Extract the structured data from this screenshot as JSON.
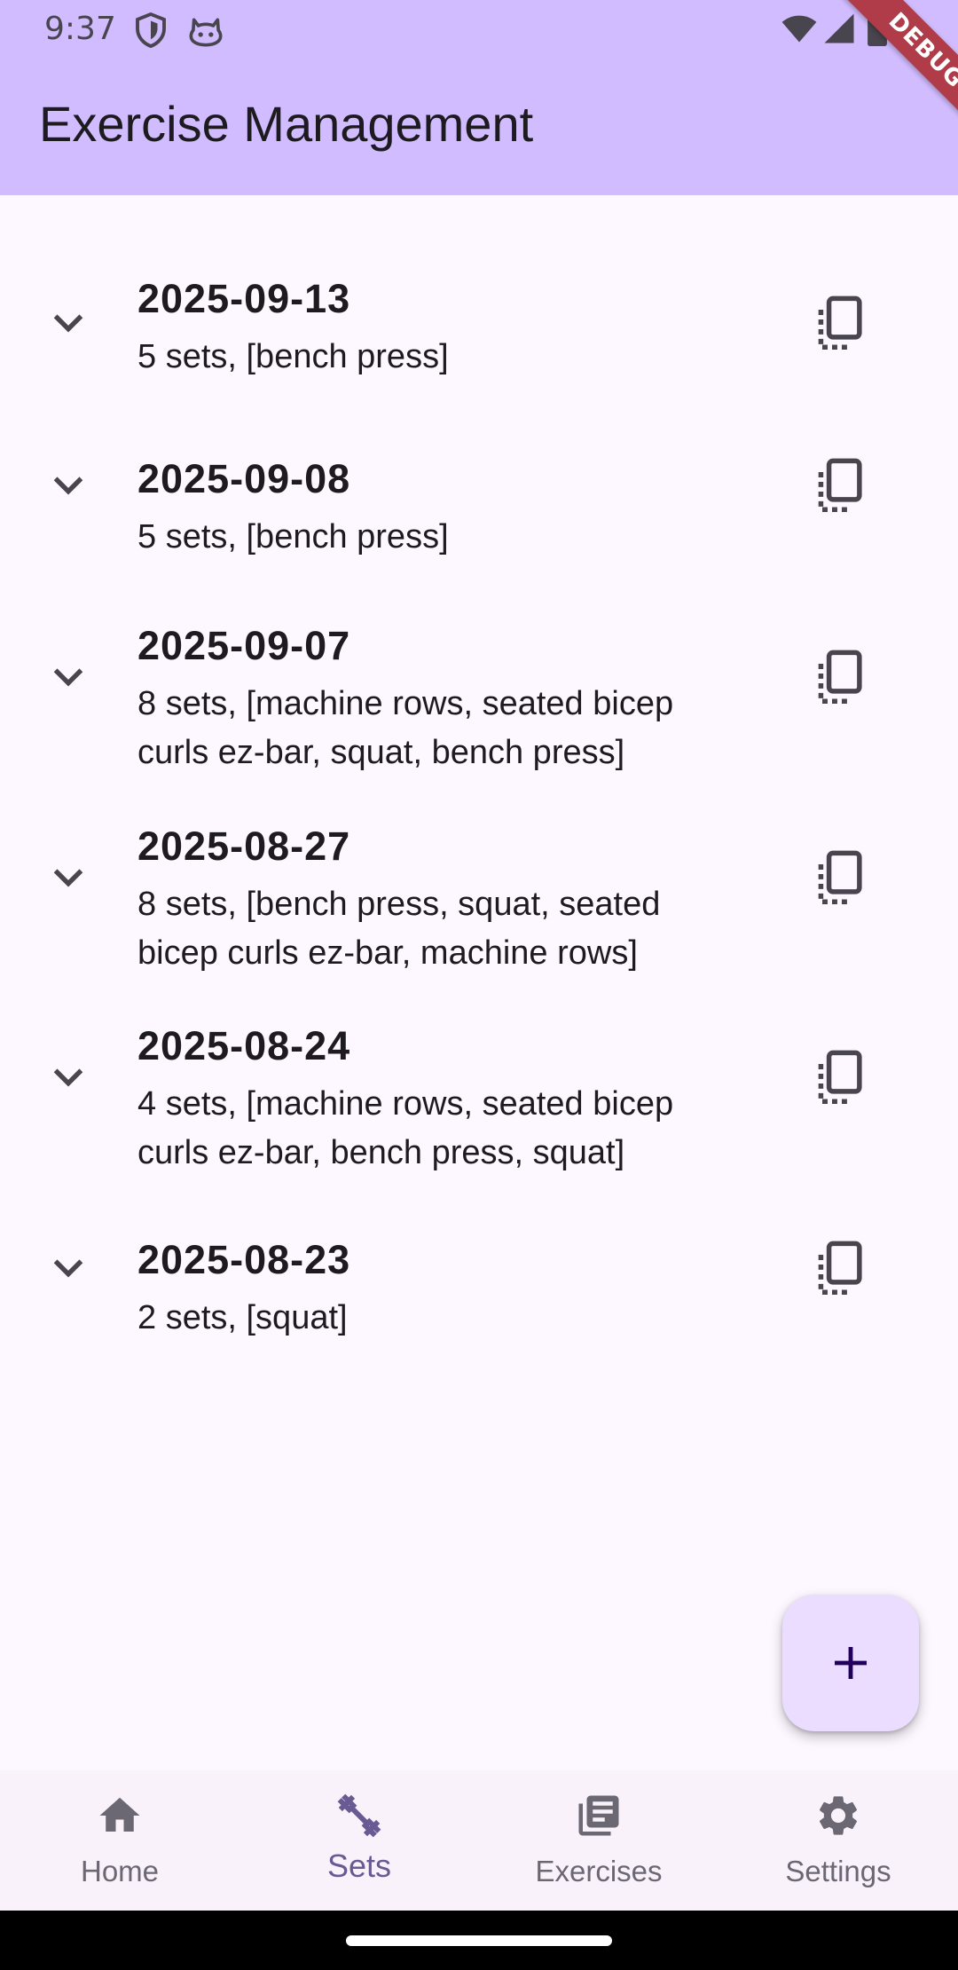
{
  "status_bar": {
    "time": "9:37",
    "icons": [
      "shield-icon",
      "cat-icon",
      "wifi-icon",
      "signal-icon",
      "battery-icon"
    ]
  },
  "debug_banner": "DEBUG",
  "app_bar": {
    "title": "Exercise Management",
    "background": "#d0bcff"
  },
  "sessions": [
    {
      "date": "2025-09-13",
      "summary": "5 sets, [bench press]"
    },
    {
      "date": "2025-09-08",
      "summary": "5 sets, [bench press]"
    },
    {
      "date": "2025-09-07",
      "summary": "8 sets, [machine rows, seated bicep curls ez-bar, squat, bench press]"
    },
    {
      "date": "2025-08-27",
      "summary": "8 sets, [bench press, squat, seated bicep curls ez-bar, machine rows]"
    },
    {
      "date": "2025-08-24",
      "summary": "4 sets, [machine rows, seated bicep curls ez-bar, bench press, squat]"
    },
    {
      "date": "2025-08-23",
      "summary": "2 sets, [squat]"
    }
  ],
  "fab": {
    "icon": "plus-icon"
  },
  "bottom_nav": {
    "items": [
      {
        "label": "Home",
        "icon": "home-icon",
        "active": false
      },
      {
        "label": "Sets",
        "icon": "dumbbell-icon",
        "active": true
      },
      {
        "label": "Exercises",
        "icon": "library-icon",
        "active": false
      },
      {
        "label": "Settings",
        "icon": "gear-icon",
        "active": false
      }
    ]
  },
  "colors": {
    "accent": "#6a5a94",
    "surface": "#fdf7ff",
    "fab": "#eaddff"
  }
}
